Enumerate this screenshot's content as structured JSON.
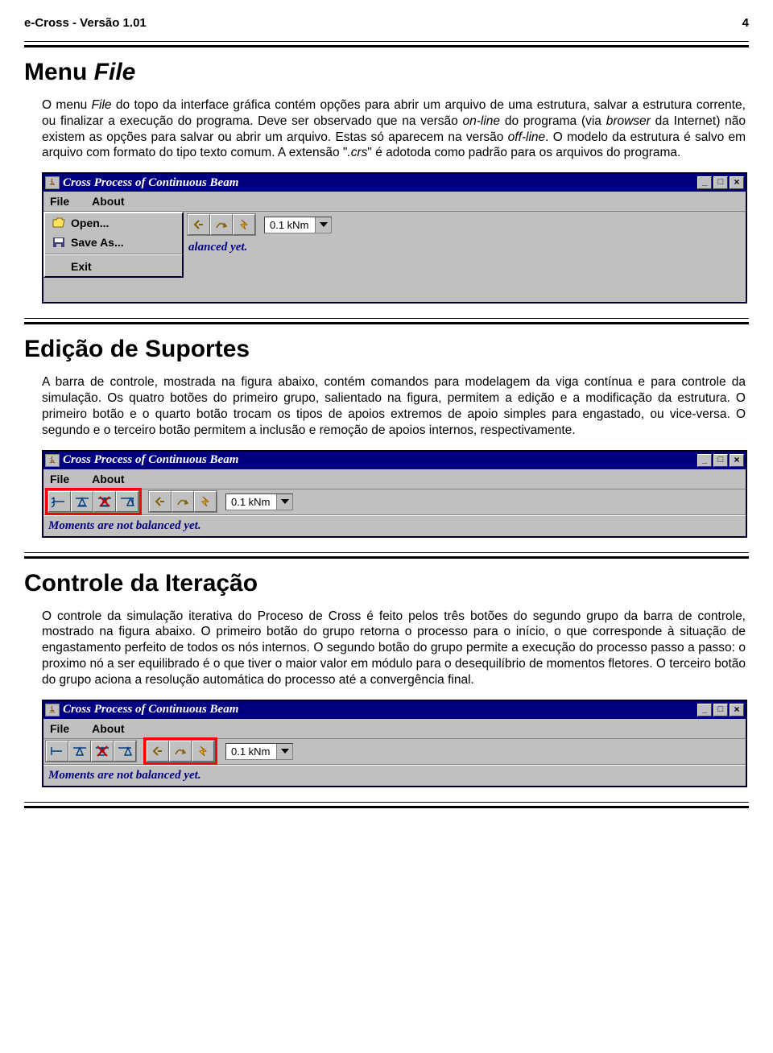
{
  "header": {
    "title": "e-Cross - Versão 1.01",
    "page_num": "4"
  },
  "section1": {
    "title_a": "Menu",
    "title_b": "File",
    "body_html": "O menu <i>File</i> do topo da interface gráfica contém opções para abrir um arquivo de uma estrutura, salvar a estrutura corrente, ou finalizar a execução do programa. Deve ser observado que na versão <i>on-line</i> do programa (via <i>browser</i> da Internet) não existem as opções para salvar ou abrir um arquivo. Estas só aparecem na versão <i>off-line</i>. O modelo da estrutura é salvo em arquivo com formato do tipo texto comum. A extensão \"<i>.crs</i>\" é adotoda como padrão para os arquivos do programa."
  },
  "section2": {
    "title": "Edição de Suportes",
    "body": "A barra de controle, mostrada na figura abaixo, contém comandos para modelagem da viga contínua e para controle da simulação. Os quatro botões do primeiro grupo, salientado na figura, permitem a edição e a modificação da estrutura. O primeiro botão e o quarto botão trocam os tipos de apoios extremos de apoio simples para engastado, ou vice-versa. O segundo e o terceiro botão permitem a inclusão e remoção de apoios internos, respectivamente."
  },
  "section3": {
    "title": "Controle da Iteração",
    "body": "O controle da simulação iterativa do Proceso de Cross é feito pelos três botões do segundo grupo da barra de controle, mostrado na figura abaixo. O primeiro botão do grupo retorna o processo para o início, o que corresponde à situação de engastamento perfeito de todos os nós internos. O segundo botão do grupo permite a execução do processo passo a passo: o proximo nó a ser equilibrado é o que tiver o maior valor em módulo para o desequilíbrio de momentos fletores. O terceiro botão do grupo aciona a resolução automática do processo até a convergência final."
  },
  "app": {
    "window_title": "Cross Process of Continuous Beam",
    "menu_file": "File",
    "menu_about": "About",
    "open": "Open...",
    "save_as": "Save As...",
    "exit": "Exit",
    "unit": "0.1 kNm",
    "status_partial": "alanced yet.",
    "status_full": "Moments are not balanced yet."
  }
}
